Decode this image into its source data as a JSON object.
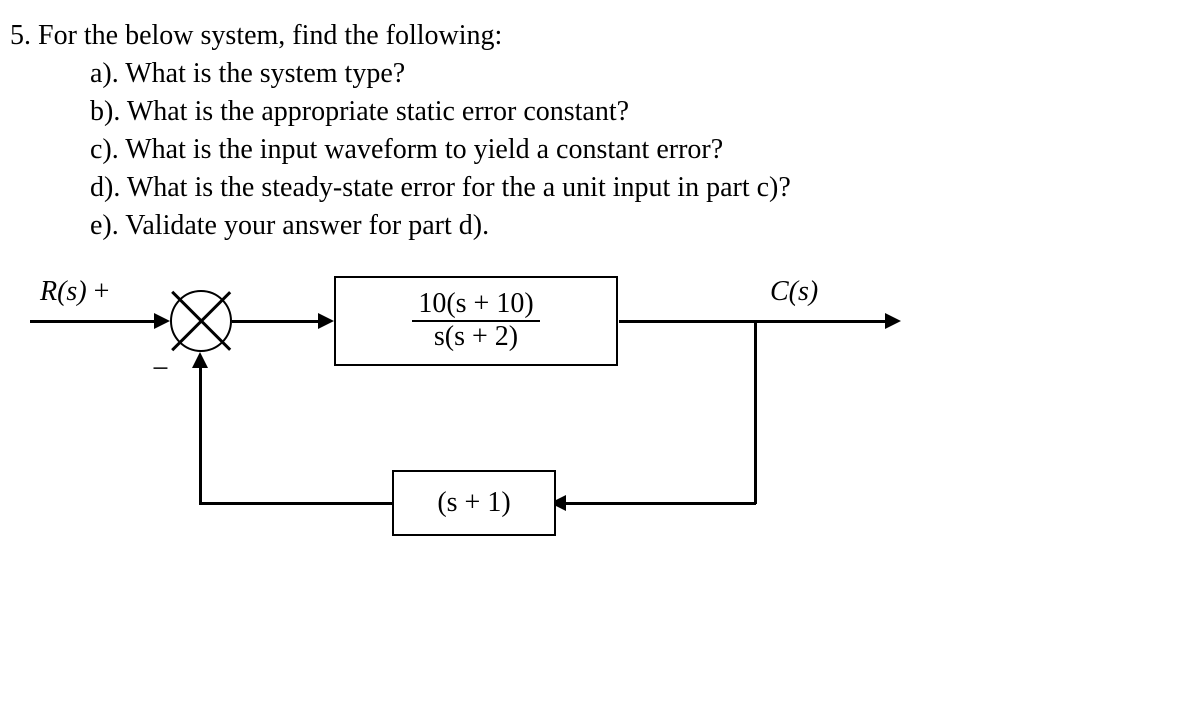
{
  "question": {
    "main": "5. For the below system, find the following:",
    "sub": {
      "a": "a). What is the system type?",
      "b": "b). What is the appropriate static error constant?",
      "c": "c). What is the input waveform to yield a constant error?",
      "d": "d). What is the steady-state error for the a unit input in part c)?",
      "e": "e). Validate your answer for part d)."
    }
  },
  "diagram": {
    "input_label": "R(s)",
    "input_sign": "+",
    "feedback_sign": "−",
    "output_label": "C(s)",
    "forward_tf": {
      "numerator": "10(s + 10)",
      "denominator": "s(s + 2)"
    },
    "feedback_tf": "(s + 1)"
  },
  "chart_data": {
    "type": "block_diagram",
    "nodes": [
      {
        "id": "R",
        "kind": "input",
        "label": "R(s)"
      },
      {
        "id": "SUM",
        "kind": "summing_junction",
        "inputs": [
          {
            "from": "R",
            "sign": "+"
          },
          {
            "from": "H",
            "sign": "-"
          }
        ]
      },
      {
        "id": "G",
        "kind": "transfer_function",
        "expr": "10(s+10) / (s(s+2))"
      },
      {
        "id": "C",
        "kind": "output",
        "label": "C(s)"
      },
      {
        "id": "H",
        "kind": "transfer_function",
        "expr": "(s+1)"
      }
    ],
    "edges": [
      {
        "from": "R",
        "to": "SUM"
      },
      {
        "from": "SUM",
        "to": "G"
      },
      {
        "from": "G",
        "to": "C"
      },
      {
        "from": "C",
        "to": "H",
        "tap": true
      },
      {
        "from": "H",
        "to": "SUM"
      }
    ]
  }
}
